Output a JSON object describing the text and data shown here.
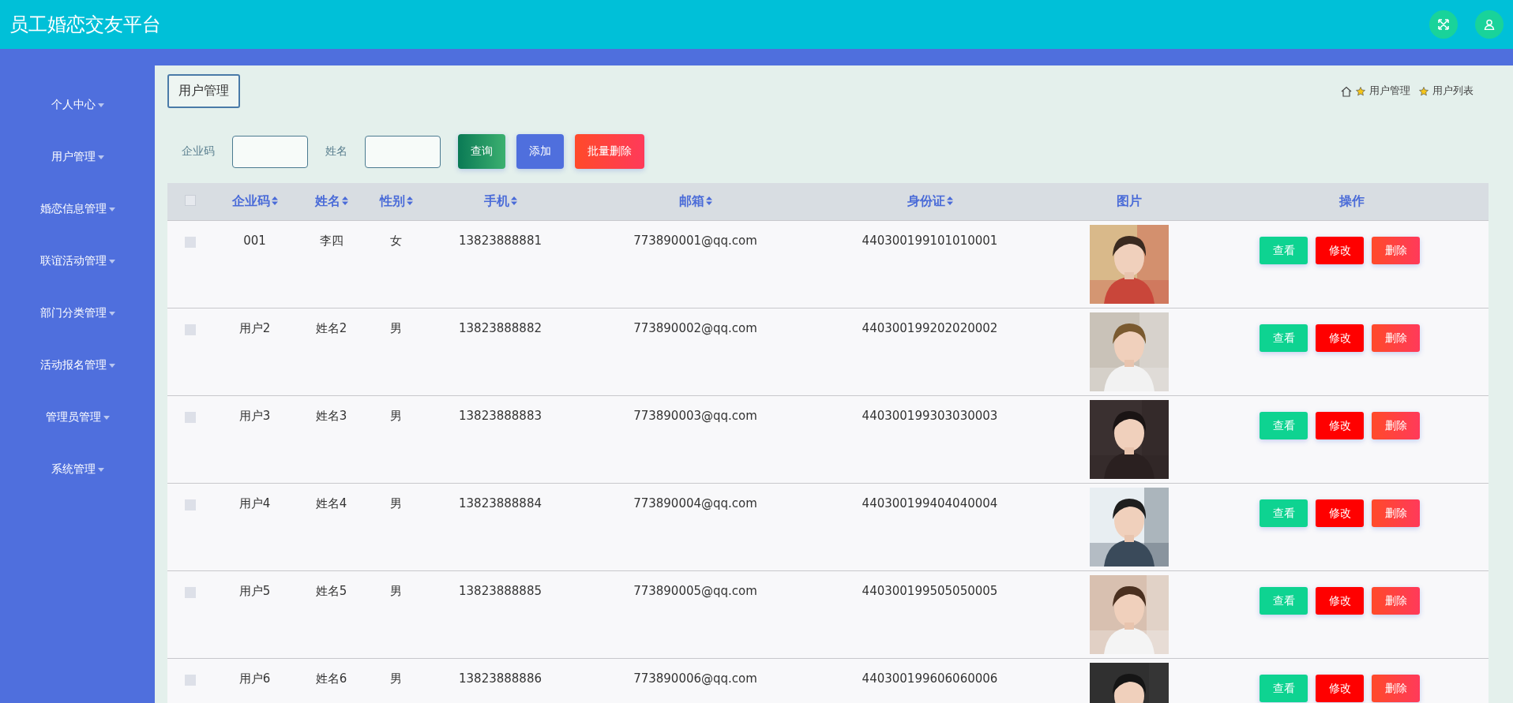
{
  "app": {
    "title": "员工婚恋交友平台"
  },
  "sidebar": {
    "items": [
      {
        "label": "个人中心"
      },
      {
        "label": "用户管理"
      },
      {
        "label": "婚恋信息管理"
      },
      {
        "label": "联谊活动管理"
      },
      {
        "label": "部门分类管理"
      },
      {
        "label": "活动报名管理"
      },
      {
        "label": "管理员管理"
      },
      {
        "label": "系统管理"
      }
    ]
  },
  "page_tab": "用户管理",
  "breadcrumb": [
    "用户管理",
    "用户列表"
  ],
  "filters": [
    {
      "label": "企业码"
    },
    {
      "label": "姓名"
    }
  ],
  "actions": [
    {
      "label": "查询",
      "kind": "search"
    },
    {
      "label": "添加",
      "kind": "add"
    },
    {
      "label": "批量删除",
      "kind": "delete"
    }
  ],
  "table": {
    "select_all": {
      "checked": false
    },
    "columns": [
      {
        "label": "企业码",
        "sortable": true
      },
      {
        "label": "姓名",
        "sortable": true
      },
      {
        "label": "性别",
        "sortable": true
      },
      {
        "label": "手机",
        "sortable": true
      },
      {
        "label": "邮箱",
        "sortable": true
      },
      {
        "label": "身份证",
        "sortable": true
      },
      {
        "label": "图片",
        "sortable": false
      },
      {
        "label": "操作",
        "sortable": false
      }
    ],
    "rows": [
      {
        "cells": [
          "001",
          "李四",
          "女",
          "13823888881",
          "773890001@qq.com",
          "440300199101010001"
        ],
        "checked": false,
        "actions": [
          {
            "label": "查看",
            "kind": "view"
          },
          {
            "label": "修改",
            "kind": "edit"
          },
          {
            "label": "删除",
            "kind": "delete"
          }
        ]
      },
      {
        "cells": [
          "用户2",
          "姓名2",
          "男",
          "13823888882",
          "773890002@qq.com",
          "440300199202020002"
        ],
        "checked": false,
        "actions": [
          {
            "label": "查看",
            "kind": "view"
          },
          {
            "label": "修改",
            "kind": "edit"
          },
          {
            "label": "删除",
            "kind": "delete"
          }
        ]
      },
      {
        "cells": [
          "用户3",
          "姓名3",
          "男",
          "13823888883",
          "773890003@qq.com",
          "440300199303030003"
        ],
        "checked": false,
        "actions": [
          {
            "label": "查看",
            "kind": "view"
          },
          {
            "label": "修改",
            "kind": "edit"
          },
          {
            "label": "删除",
            "kind": "delete"
          }
        ]
      },
      {
        "cells": [
          "用户4",
          "姓名4",
          "男",
          "13823888884",
          "773890004@qq.com",
          "440300199404040004"
        ],
        "checked": false,
        "actions": [
          {
            "label": "查看",
            "kind": "view"
          },
          {
            "label": "修改",
            "kind": "edit"
          },
          {
            "label": "删除",
            "kind": "delete"
          }
        ]
      },
      {
        "cells": [
          "用户5",
          "姓名5",
          "男",
          "13823888885",
          "773890005@qq.com",
          "440300199505050005"
        ],
        "checked": false,
        "actions": [
          {
            "label": "查看",
            "kind": "view"
          },
          {
            "label": "修改",
            "kind": "edit"
          },
          {
            "label": "删除",
            "kind": "delete"
          }
        ]
      },
      {
        "cells": [
          "用户6",
          "姓名6",
          "男",
          "13823888886",
          "773890006@qq.com",
          "440300199606060006"
        ],
        "checked": false,
        "actions": [
          {
            "label": "查看",
            "kind": "view"
          },
          {
            "label": "修改",
            "kind": "edit"
          },
          {
            "label": "删除",
            "kind": "delete"
          }
        ]
      }
    ]
  }
}
